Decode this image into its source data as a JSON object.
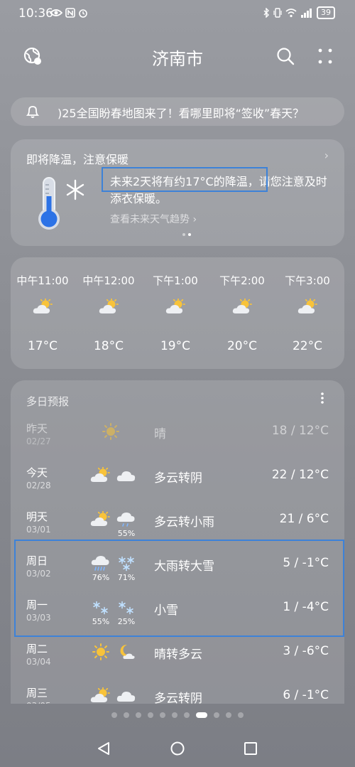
{
  "status_bar": {
    "time": "10:36",
    "left_icons": [
      "eye-icon",
      "nfc-icon",
      "alarm-icon"
    ],
    "right_icons": [
      "bluetooth-icon",
      "vibrate-icon",
      "wifi-icon",
      "signal-icon"
    ],
    "battery": "39"
  },
  "header": {
    "city": "济南市"
  },
  "notice": {
    "text": ")25全国盼春地图来了！看哪里即将“签收”春天？"
  },
  "alert": {
    "title": "即将降温，注意保暖",
    "body": "未来2天将有约17°C的降温，请您注意及时添衣保暖。",
    "link": "查看未来天气趋势 ›",
    "chevron": "›"
  },
  "hourly": [
    {
      "time": "中午11:00",
      "temp": "17°C",
      "icon": "partly-cloudy-icon"
    },
    {
      "time": "中午12:00",
      "temp": "18°C",
      "icon": "partly-cloudy-icon"
    },
    {
      "time": "下午1:00",
      "temp": "19°C",
      "icon": "partly-cloudy-icon"
    },
    {
      "time": "下午2:00",
      "temp": "20°C",
      "icon": "partly-cloudy-icon"
    },
    {
      "time": "下午3:00",
      "temp": "22°C",
      "icon": "partly-cloudy-icon"
    }
  ],
  "daily": {
    "title": "多日预报",
    "rows": [
      {
        "day": "昨天",
        "date": "02/27",
        "desc": "晴",
        "temp": "18 / 12°C",
        "icons": [
          "sun-icon"
        ],
        "pcts": [
          "",
          ""
        ]
      },
      {
        "day": "今天",
        "date": "02/28",
        "desc": "多云转阴",
        "temp": "22 / 12°C",
        "icons": [
          "partly-cloudy-icon",
          "cloud-icon"
        ],
        "pcts": [
          "",
          ""
        ]
      },
      {
        "day": "明天",
        "date": "03/01",
        "desc": "多云转小雨",
        "temp": "21 / 6°C",
        "icons": [
          "partly-cloudy-icon",
          "light-rain-icon"
        ],
        "pcts": [
          "",
          "55%"
        ]
      },
      {
        "day": "周日",
        "date": "03/02",
        "desc": "大雨转大雪",
        "temp": "5 / -1°C",
        "icons": [
          "heavy-rain-icon",
          "heavy-snow-icon"
        ],
        "pcts": [
          "76%",
          "71%"
        ]
      },
      {
        "day": "周一",
        "date": "03/03",
        "desc": "小雪",
        "temp": "1 / -4°C",
        "icons": [
          "snow-icon",
          "snow-icon"
        ],
        "pcts": [
          "55%",
          "25%"
        ]
      },
      {
        "day": "周二",
        "date": "03/04",
        "desc": "晴转多云",
        "temp": "3 / -6°C",
        "icons": [
          "sun-icon",
          "moon-cloud-icon"
        ],
        "pcts": [
          "",
          ""
        ]
      },
      {
        "day": "周三",
        "date": "03/05",
        "desc": "多云转阴",
        "temp": "6 / -1°C",
        "icons": [
          "partly-cloudy-icon",
          "cloud-icon"
        ],
        "pcts": [
          "",
          ""
        ]
      }
    ]
  },
  "page_indicator": {
    "count": 11,
    "active_index": 7
  }
}
